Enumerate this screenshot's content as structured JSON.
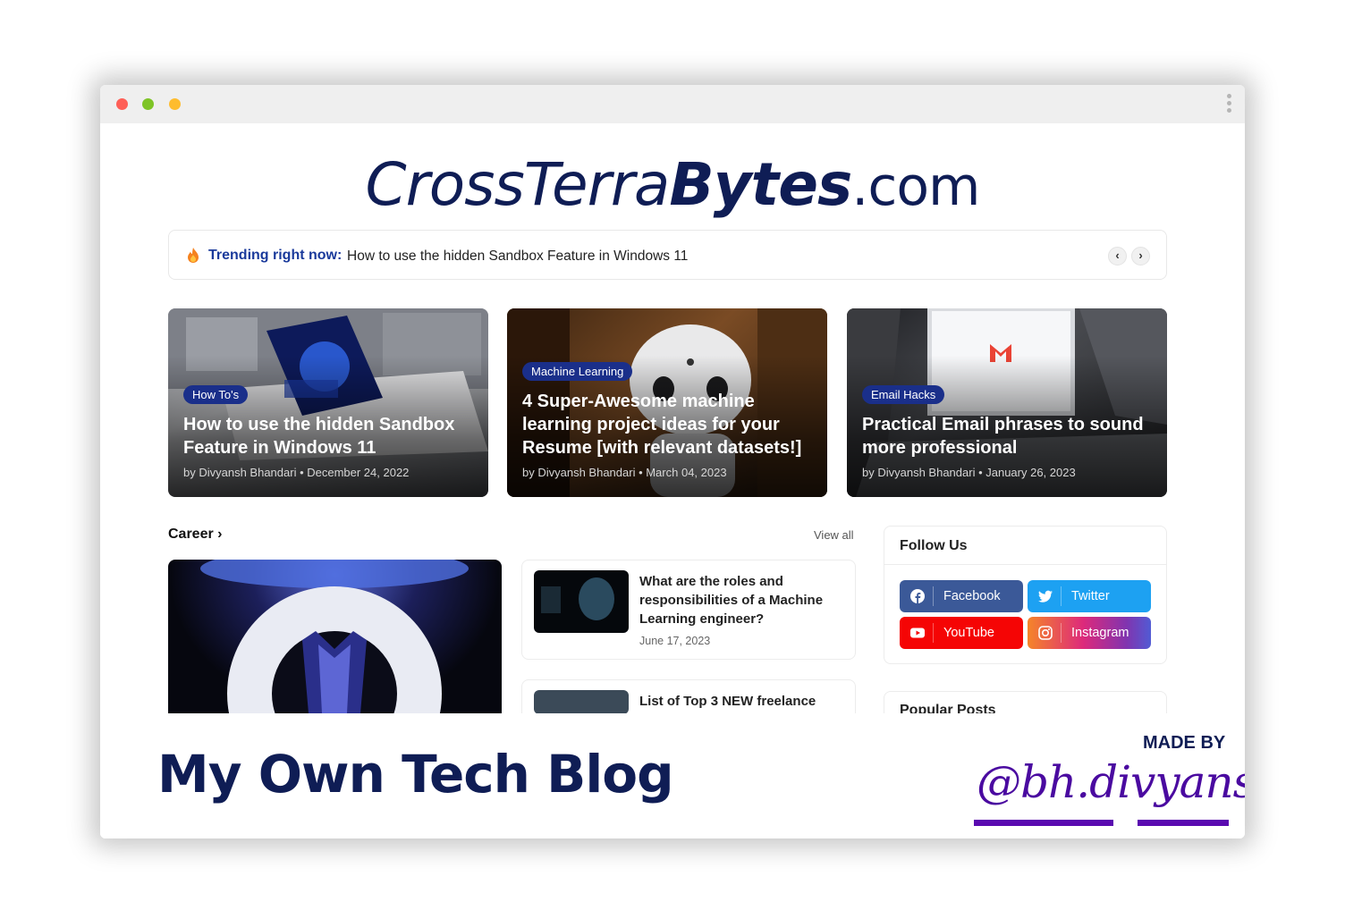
{
  "logo": {
    "part1": "CrossTerra",
    "part2": "Bytes",
    "part3": ".com"
  },
  "trending": {
    "label": "Trending right now:",
    "title": "How to use the hidden Sandbox Feature in Windows 11",
    "prev": "‹",
    "next": "›"
  },
  "featured": [
    {
      "category": "How To's",
      "title": "How to use the hidden Sandbox Feature in Windows 11",
      "meta": "by Divyansh Bhandari • December 24, 2022"
    },
    {
      "category": "Machine Learning",
      "title": "4 Super-Awesome machine learning project ideas for your Resume [with relevant datasets!]",
      "meta": "by Divyansh Bhandari • March 04, 2023"
    },
    {
      "category": "Email Hacks",
      "title": "Practical Email phrases to sound more professional",
      "meta": "by Divyansh Bhandari • January 26, 2023"
    }
  ],
  "career": {
    "heading": "Career ›",
    "view_all": "View all",
    "posts": [
      {
        "title": "What are the roles and responsibilities of a Machine Learning engineer?",
        "date": "June 17, 2023"
      },
      {
        "title": "List of Top 3 NEW freelance",
        "date": ""
      }
    ]
  },
  "follow": {
    "title": "Follow Us",
    "buttons": [
      {
        "label": "Facebook",
        "icon": "facebook-icon",
        "color": "#3b5998"
      },
      {
        "label": "Twitter",
        "icon": "twitter-icon",
        "color": "#1da1f2"
      },
      {
        "label": "YouTube",
        "icon": "youtube-icon",
        "color": "#f50505"
      },
      {
        "label": "Instagram",
        "icon": "instagram-icon",
        "color": "#dd2a7b"
      }
    ]
  },
  "popular": {
    "title": "Popular Posts"
  },
  "footer": {
    "tagline": "My Own Tech Blog",
    "made_by": "MADE BY",
    "handle": "@bh.divyansh"
  },
  "colors": {
    "brand": "#0f1d55",
    "accent": "#1a3a9b",
    "handle": "#4a0aa0"
  }
}
